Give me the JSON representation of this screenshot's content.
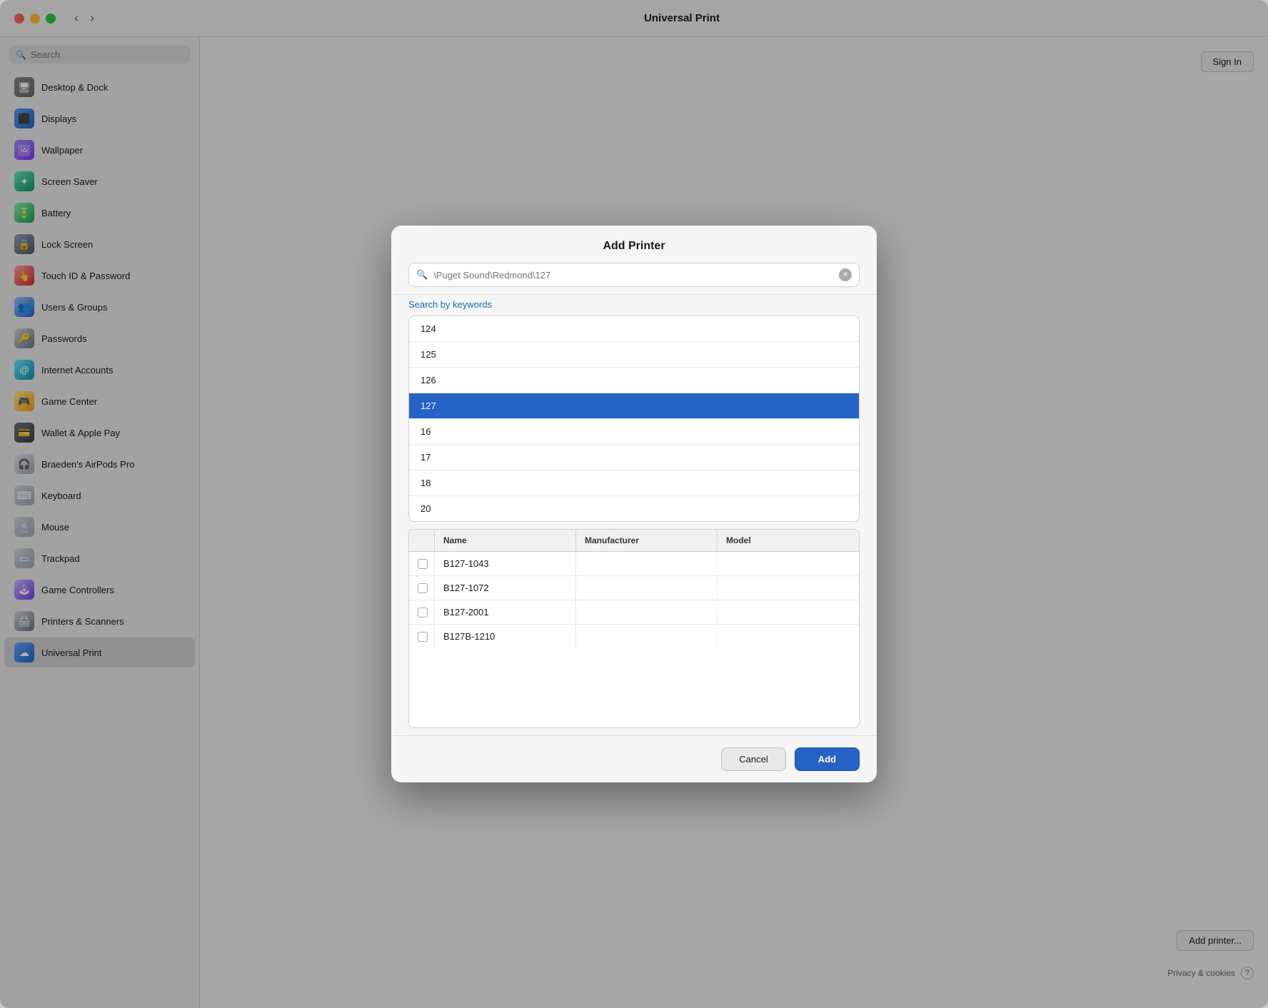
{
  "window": {
    "title": "Universal Print"
  },
  "titlebar": {
    "back_label": "‹",
    "forward_label": "›",
    "title": "Universal Print"
  },
  "sidebar": {
    "search_placeholder": "Search",
    "items": [
      {
        "id": "desktop-dock",
        "label": "Desktop & Dock",
        "icon": "🖥",
        "icon_class": "icon-desktop"
      },
      {
        "id": "displays",
        "label": "Displays",
        "icon": "⬛",
        "icon_class": "icon-displays"
      },
      {
        "id": "wallpaper",
        "label": "Wallpaper",
        "icon": "🖼",
        "icon_class": "icon-wallpaper"
      },
      {
        "id": "screen-saver",
        "label": "Screen Saver",
        "icon": "✦",
        "icon_class": "icon-screensaver"
      },
      {
        "id": "battery",
        "label": "Battery",
        "icon": "🔋",
        "icon_class": "icon-battery"
      },
      {
        "id": "lock-screen",
        "label": "Lock Screen",
        "icon": "🔒",
        "icon_class": "icon-lockscreen"
      },
      {
        "id": "touch-id",
        "label": "Touch ID & Password",
        "icon": "👆",
        "icon_class": "icon-touchid"
      },
      {
        "id": "users-groups",
        "label": "Users & Groups",
        "icon": "👥",
        "icon_class": "icon-users"
      },
      {
        "id": "passwords",
        "label": "Passwords",
        "icon": "🔑",
        "icon_class": "icon-passwords"
      },
      {
        "id": "internet-accounts",
        "label": "Internet Accounts",
        "icon": "@",
        "icon_class": "icon-internet"
      },
      {
        "id": "game-center",
        "label": "Game Center",
        "icon": "🎮",
        "icon_class": "icon-gamecenter"
      },
      {
        "id": "wallet-apple-pay",
        "label": "Wallet & Apple Pay",
        "icon": "💳",
        "icon_class": "icon-wallet"
      },
      {
        "id": "airpods",
        "label": "Braeden's AirPods Pro",
        "icon": "🎧",
        "icon_class": "icon-airpods"
      },
      {
        "id": "keyboard",
        "label": "Keyboard",
        "icon": "⌨",
        "icon_class": "icon-keyboard"
      },
      {
        "id": "mouse",
        "label": "Mouse",
        "icon": "🖱",
        "icon_class": "icon-mouse"
      },
      {
        "id": "trackpad",
        "label": "Trackpad",
        "icon": "▭",
        "icon_class": "icon-trackpad"
      },
      {
        "id": "game-controllers",
        "label": "Game Controllers",
        "icon": "🕹",
        "icon_class": "icon-gamecontrollers"
      },
      {
        "id": "printers-scanners",
        "label": "Printers & Scanners",
        "icon": "🖨",
        "icon_class": "icon-printers"
      },
      {
        "id": "universal-print",
        "label": "Universal Print",
        "icon": "☁",
        "icon_class": "icon-universalprint",
        "active": true
      }
    ]
  },
  "main": {
    "sign_in_label": "Sign In",
    "add_printer_label": "Add printer...",
    "privacy_label": "Privacy & cookies",
    "help_label": "?"
  },
  "modal": {
    "title": "Add Printer",
    "search_value": "\\Puget Sound\\Redmond\\127",
    "search_placeholder": "\\Puget Sound\\Redmond\\127",
    "search_by_keywords_label": "Search by keywords",
    "printer_list": [
      {
        "id": "124",
        "label": "124",
        "selected": false
      },
      {
        "id": "125",
        "label": "125",
        "selected": false
      },
      {
        "id": "126",
        "label": "126",
        "selected": false
      },
      {
        "id": "127",
        "label": "127",
        "selected": true
      },
      {
        "id": "16",
        "label": "16",
        "selected": false
      },
      {
        "id": "17",
        "label": "17",
        "selected": false
      },
      {
        "id": "18",
        "label": "18",
        "selected": false
      },
      {
        "id": "20",
        "label": "20",
        "selected": false
      }
    ],
    "table": {
      "columns": [
        {
          "id": "checkbox",
          "label": ""
        },
        {
          "id": "name",
          "label": "Name"
        },
        {
          "id": "manufacturer",
          "label": "Manufacturer"
        },
        {
          "id": "model",
          "label": "Model"
        }
      ],
      "rows": [
        {
          "name": "B127-1043",
          "manufacturer": "",
          "model": ""
        },
        {
          "name": "B127-1072",
          "manufacturer": "",
          "model": ""
        },
        {
          "name": "B127-2001",
          "manufacturer": "",
          "model": ""
        },
        {
          "name": "B127B-1210",
          "manufacturer": "",
          "model": ""
        }
      ]
    },
    "cancel_label": "Cancel",
    "add_label": "Add"
  }
}
